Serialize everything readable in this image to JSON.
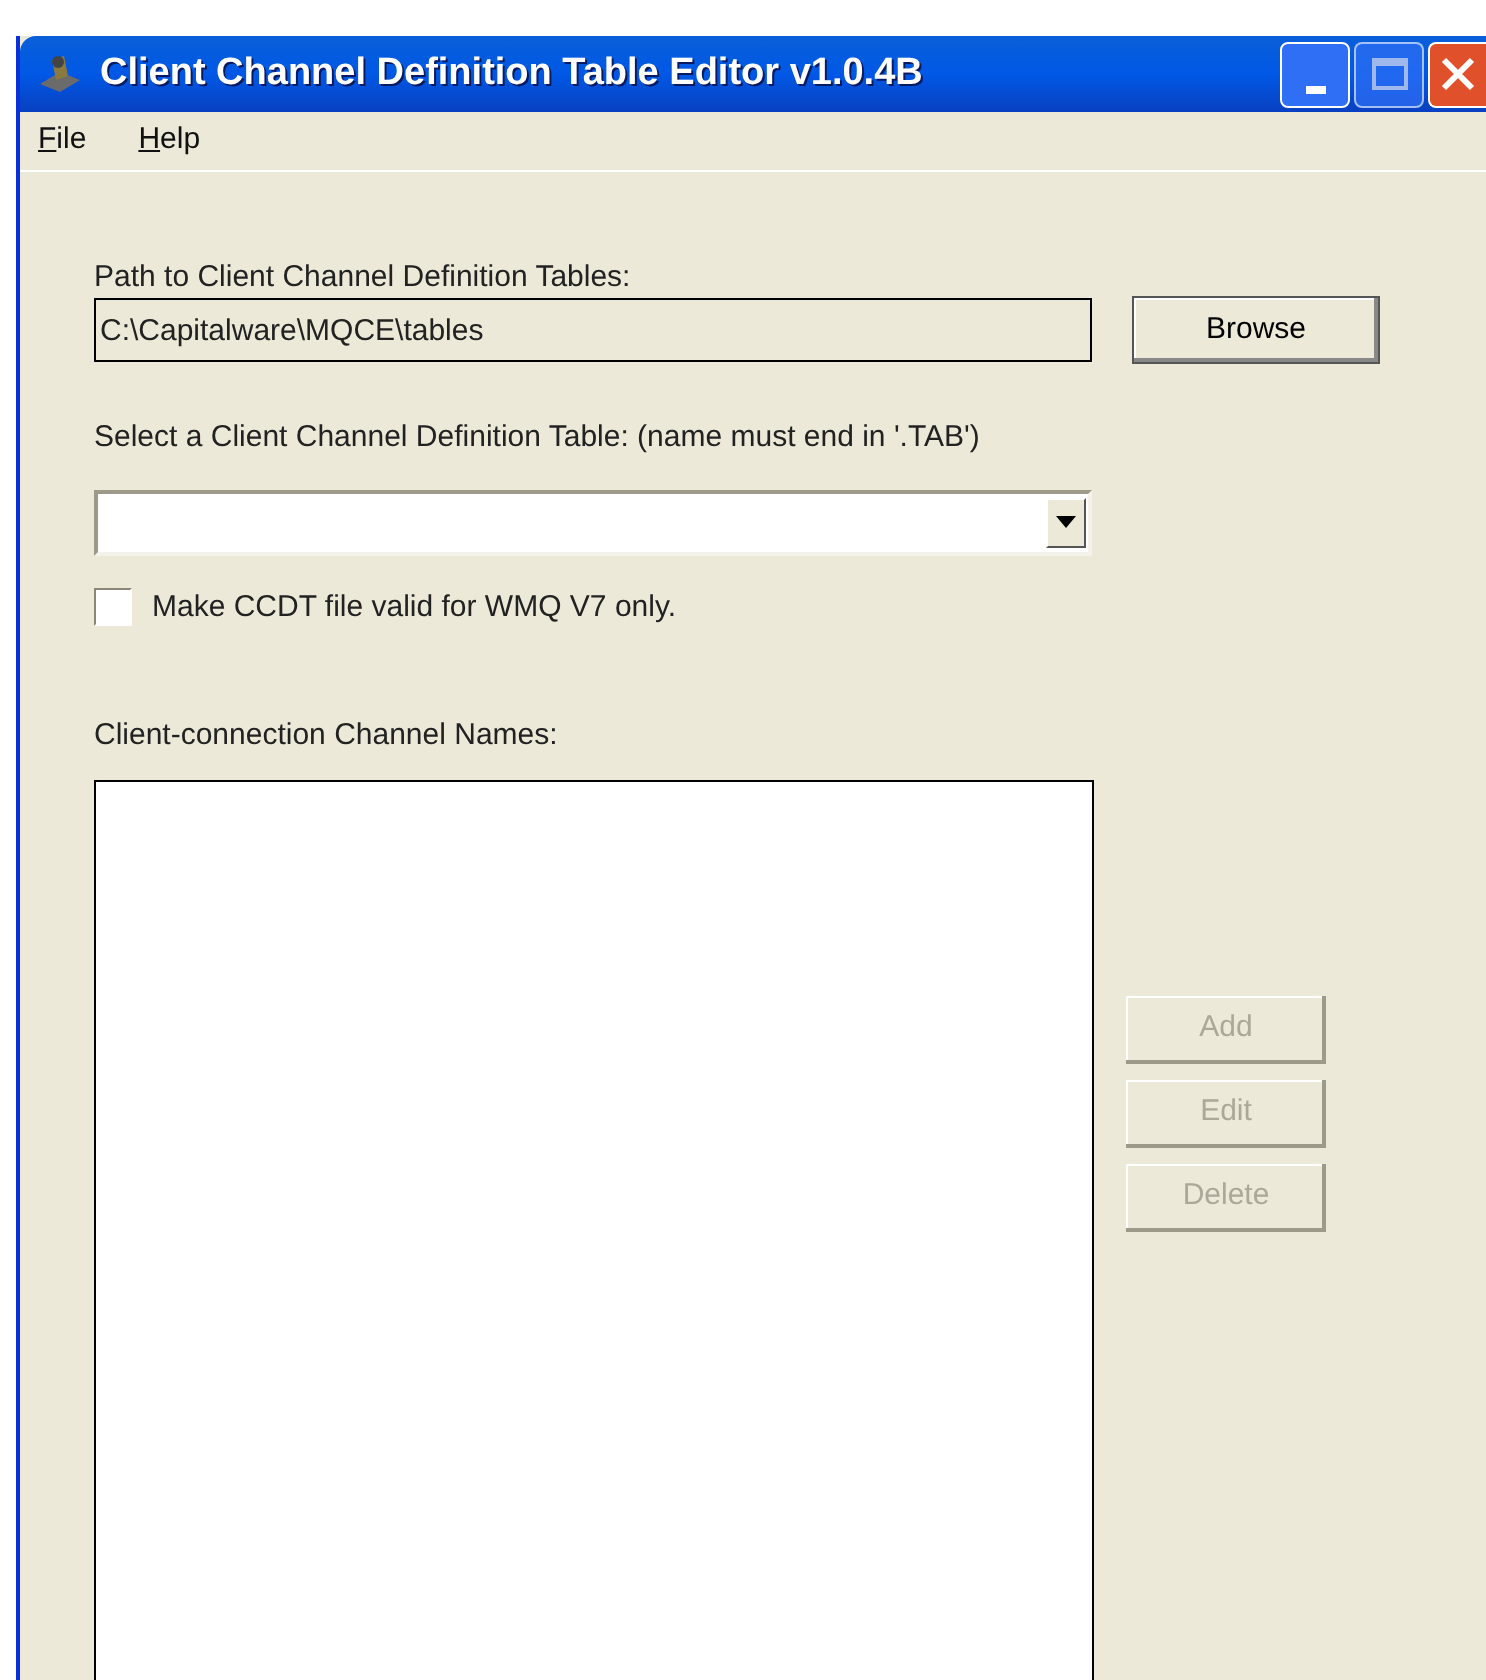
{
  "window": {
    "title": "Client Channel Definition Table Editor v1.0.4B"
  },
  "menu": [
    {
      "label": "File"
    },
    {
      "label": "Help"
    }
  ],
  "path": {
    "label": "Path to Client Channel Definition Tables:",
    "value": "C:\\Capitalware\\MQCE\\tables",
    "button": "Browse"
  },
  "table_select": {
    "label": "Select a Client Channel Definition Table: (name must end in '.TAB')"
  },
  "v7_only": {
    "label": "Make CCDT file valid for WMQ V7 only.",
    "checked": false
  },
  "channels": {
    "label": "Client-connection Channel Names:"
  },
  "buttons": [
    {
      "label": "Add",
      "disabled": true
    },
    {
      "label": "Edit",
      "disabled": true
    },
    {
      "label": "Delete",
      "disabled": true
    }
  ]
}
